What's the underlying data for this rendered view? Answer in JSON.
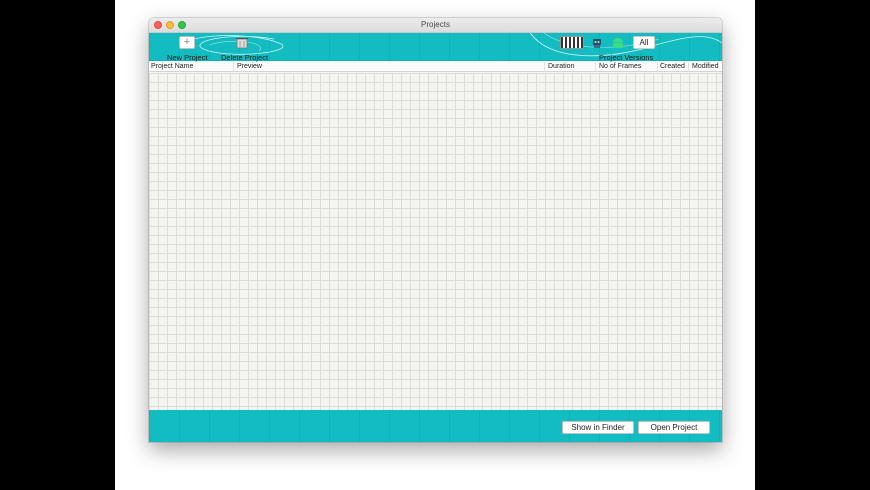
{
  "window": {
    "title": "Projects"
  },
  "toolbar": {
    "new_project_label": "New Project",
    "delete_project_label": "Delete Project",
    "project_versions_label": "Project Versions",
    "all_label": "All",
    "add_symbol": "+"
  },
  "columns": [
    "Project Name",
    "Preview",
    "Duration",
    "No of Frames",
    "Created",
    "Modified"
  ],
  "footer": {
    "show_in_finder_label": "Show in Finder",
    "open_project_label": "Open Project"
  },
  "colors": {
    "accent": "#12bcc0"
  },
  "icons": [
    "plus-icon",
    "delete-project-icon",
    "film-version-icon",
    "robot-version-icon",
    "android-version-icon"
  ]
}
